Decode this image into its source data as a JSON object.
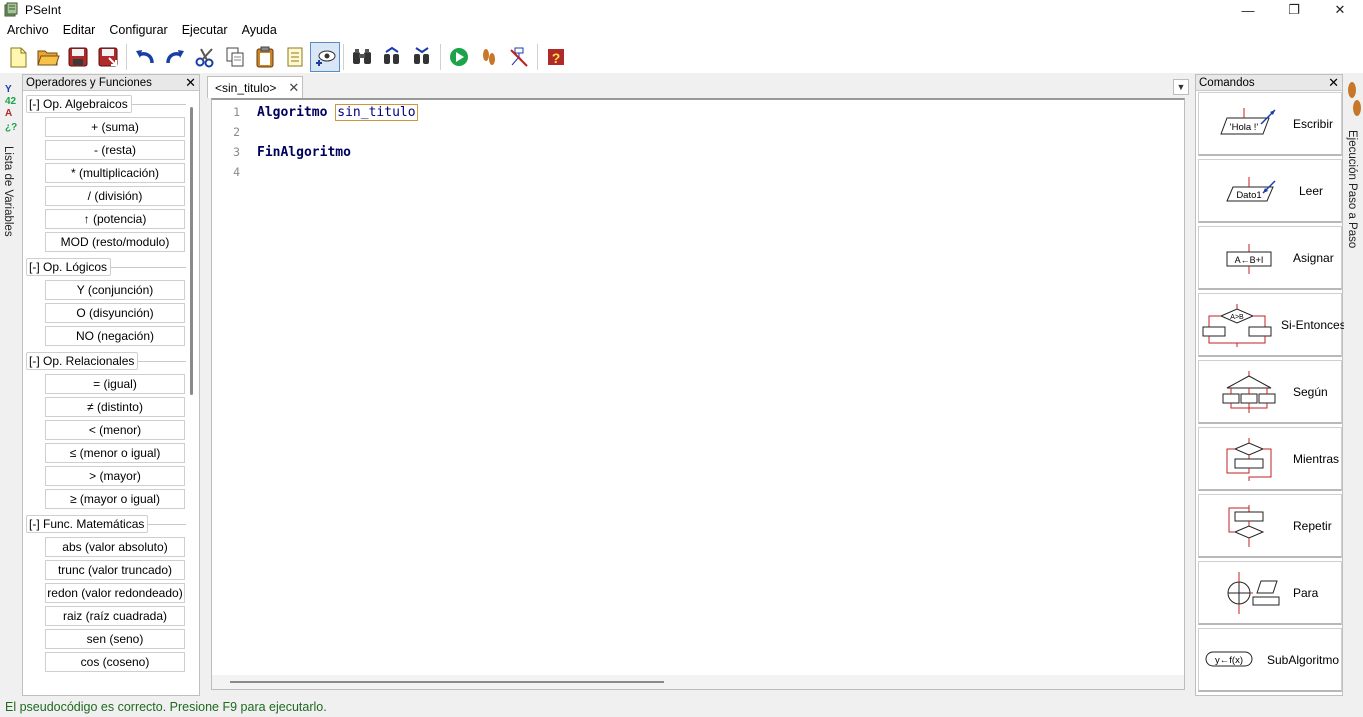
{
  "window": {
    "title": "PSeInt",
    "minimize": "—",
    "maximize": "❐",
    "close": "✕"
  },
  "menu": [
    "Archivo",
    "Editar",
    "Configurar",
    "Ejecutar",
    "Ayuda"
  ],
  "left_strip": {
    "label": "Lista de Variables"
  },
  "left_panel": {
    "title": "Operadores y Funciones",
    "close": "✕",
    "groups": [
      {
        "header": "[-]  Op. Algebraicos",
        "items": [
          "+ (suma)",
          "- (resta)",
          "* (multiplicación)",
          "/ (división)",
          "↑ (potencia)",
          "MOD (resto/modulo)"
        ]
      },
      {
        "header": "[-]  Op. Lógicos",
        "items": [
          "Y (conjunción)",
          "O (disyunción)",
          "NO (negación)"
        ]
      },
      {
        "header": "[-]  Op. Relacionales",
        "items": [
          "= (igual)",
          "≠ (distinto)",
          "< (menor)",
          "≤ (menor o igual)",
          "> (mayor)",
          "≥ (mayor o igual)"
        ]
      },
      {
        "header": "[-]  Func. Matemáticas",
        "items": [
          "abs (valor absoluto)",
          "trunc (valor truncado)",
          "redon (valor redondeado)",
          "raiz (raíz cuadrada)",
          "sen (seno)",
          "cos (coseno)"
        ]
      }
    ]
  },
  "editor": {
    "tab": {
      "label": "<sin_titulo>",
      "close": "✕"
    },
    "dropdown": "▼",
    "lines": [
      {
        "num": "1",
        "keyword": "Algoritmo",
        "ident": "sin_titulo"
      },
      {
        "num": "2",
        "keyword": "",
        "ident": ""
      },
      {
        "num": "3",
        "keyword": "FinAlgoritmo",
        "ident": ""
      },
      {
        "num": "4",
        "keyword": "",
        "ident": ""
      }
    ]
  },
  "right_panel": {
    "title": "Comandos",
    "close": "✕",
    "commands": [
      {
        "label": "Escribir",
        "icon": "write-icon",
        "glyph": "'Hola !'"
      },
      {
        "label": "Leer",
        "icon": "read-icon",
        "glyph": "Dato1"
      },
      {
        "label": "Asignar",
        "icon": "assign-icon",
        "glyph": "A←B+I"
      },
      {
        "label": "Si-Entonces",
        "icon": "if-then-icon",
        "glyph": "A>B"
      },
      {
        "label": "Según",
        "icon": "switch-icon",
        "glyph": ""
      },
      {
        "label": "Mientras",
        "icon": "while-icon",
        "glyph": ""
      },
      {
        "label": "Repetir",
        "icon": "repeat-icon",
        "glyph": ""
      },
      {
        "label": "Para",
        "icon": "for-icon",
        "glyph": ""
      },
      {
        "label": "SubAlgoritmo",
        "icon": "subalgorithm-icon",
        "glyph": "y←f(x)"
      }
    ]
  },
  "right_strip": {
    "label": "Ejecución Paso a Paso"
  },
  "status": {
    "text": "El pseudocódigo es correcto. Presione F9 para ejecutarlo."
  },
  "colors": {
    "keyword": "#00005f",
    "status_ok": "#1e6a1e",
    "accent": "#5a8ac8"
  }
}
